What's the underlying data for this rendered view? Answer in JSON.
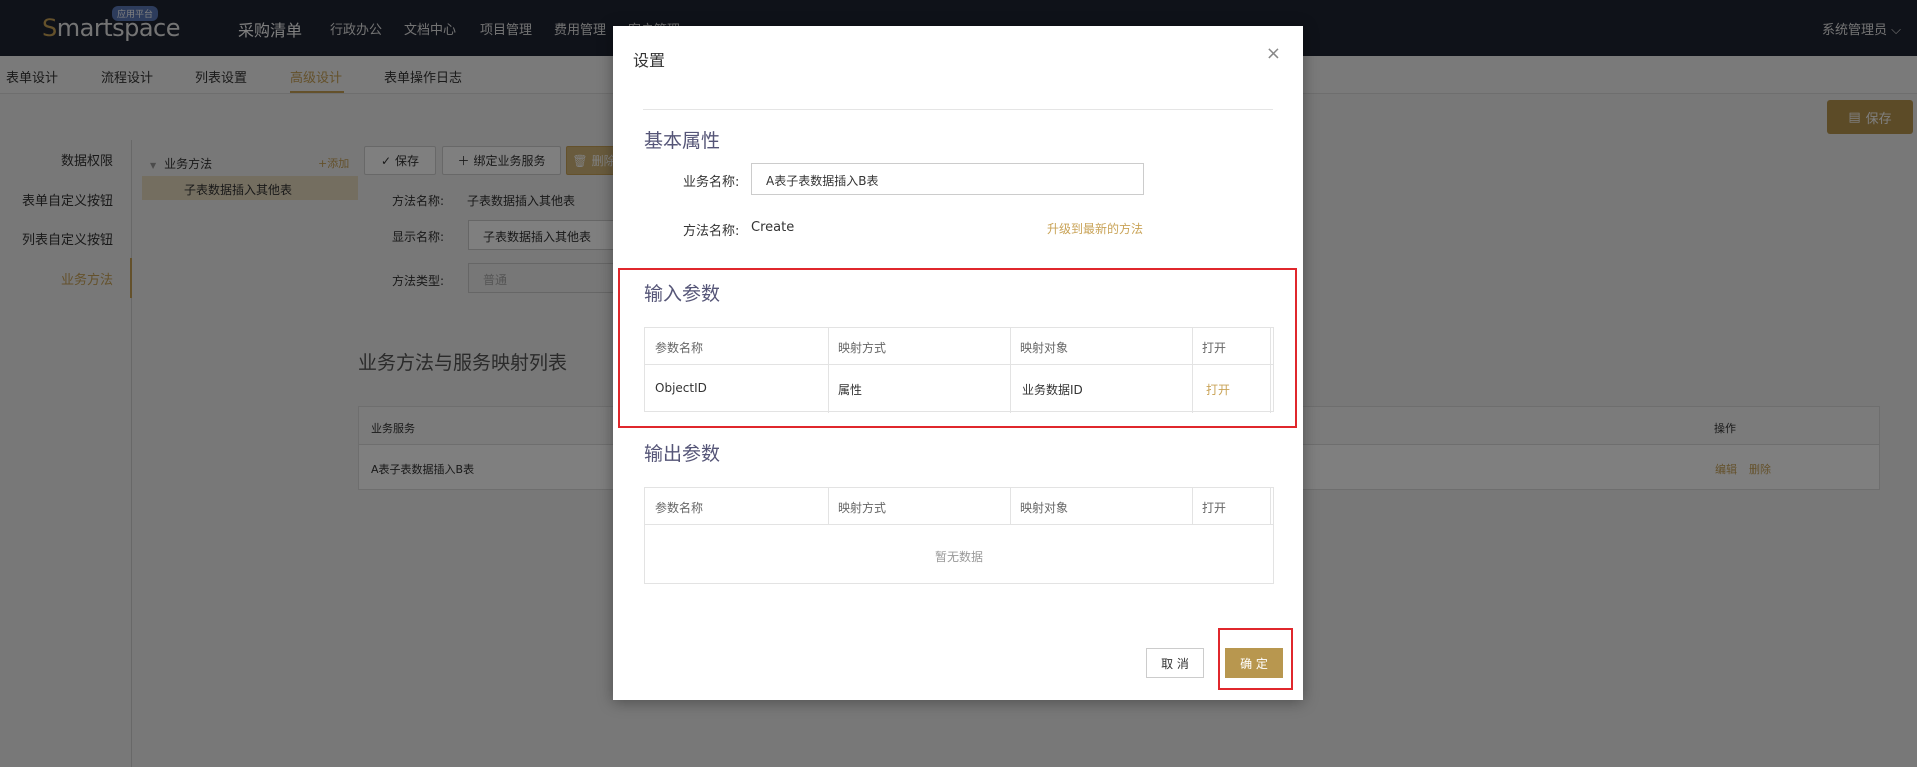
{
  "topbar": {
    "logo_s": "S",
    "logo_rest": "martspace",
    "logo_badge": "应用平台",
    "main_nav": "采购清单",
    "nav_items": [
      "行政办公",
      "文档中心",
      "项目管理",
      "费用管理",
      "客户管理"
    ],
    "user": "系统管理员"
  },
  "subtabs": [
    "表单设计",
    "流程设计",
    "列表设置",
    "高级设计",
    "表单操作日志"
  ],
  "top_save": "保存",
  "leftnav": [
    "数据权限",
    "表单自定义按钮",
    "列表自定义按钮",
    "业务方法"
  ],
  "tree": {
    "root": "业务方法",
    "add": "+添加",
    "child": "子表数据插入其他表"
  },
  "toolbar": {
    "save": "保存",
    "bind": "绑定业务服务",
    "delete": "删除"
  },
  "form": {
    "method_name_label": "方法名称:",
    "method_name_value": "子表数据插入其他表",
    "display_name_label": "显示名称:",
    "display_name_value": "子表数据插入其他表",
    "method_type_label": "方法类型:",
    "method_type_value": "普通"
  },
  "mapping": {
    "title": "业务方法与服务映射列表",
    "header_service": "业务服务",
    "header_action": "操作",
    "row_service": "A表子表数据插入B表",
    "edit": "编辑",
    "delete": "删除"
  },
  "modal": {
    "title": "设置",
    "close": "×",
    "basic_title": "基本属性",
    "biz_name_label": "业务名称:",
    "biz_name_value": "A表子表数据插入B表",
    "method_label": "方法名称:",
    "method_value": "Create",
    "upgrade_link": "升级到最新的方法",
    "input_title": "输入参数",
    "output_title": "输出参数",
    "param_headers": [
      "参数名称",
      "映射方式",
      "映射对象",
      "打开"
    ],
    "input_row": {
      "name": "ObjectID",
      "mode": "属性",
      "target": "业务数据ID",
      "open": "打开"
    },
    "empty": "暂无数据",
    "cancel": "取 消",
    "ok": "确 定"
  },
  "colors": {
    "accent": "#c9a357",
    "highlight": "#e0272c",
    "topbar": "#1f2433"
  }
}
